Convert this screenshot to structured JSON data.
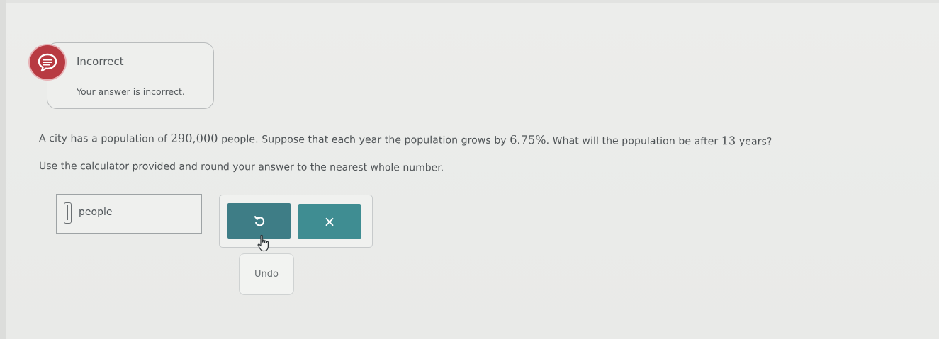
{
  "feedback": {
    "title": "Incorrect",
    "message": "Your answer is incorrect.",
    "icon": "speech-bubble-icon",
    "accent_color": "#b83a42"
  },
  "question": {
    "part1": "A city has a population of ",
    "population": "290,000",
    "part2": " people. Suppose that each year the population grows by ",
    "rate": "6.75%",
    "part3": ". What will the population be after ",
    "years": "13",
    "part4": " years?",
    "instruction": "Use the calculator provided and round your answer to the nearest whole number."
  },
  "answer": {
    "value": "",
    "unit": "people"
  },
  "buttons": {
    "undo_icon": "undo-icon",
    "clear_symbol": "×",
    "button_color": "#3e7d86"
  },
  "tooltip": {
    "text": "Undo"
  }
}
